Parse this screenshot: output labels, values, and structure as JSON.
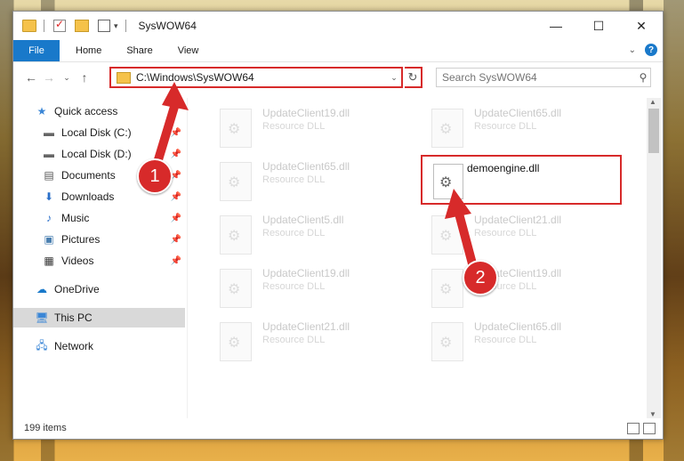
{
  "window": {
    "title": "SysWOW64"
  },
  "ribbon": {
    "tabs": [
      "File",
      "Home",
      "Share",
      "View"
    ]
  },
  "address": {
    "path": "C:\\Windows\\SysWOW64",
    "search_placeholder": "Search SysWOW64"
  },
  "sidebar": {
    "items": [
      {
        "label": "Quick access",
        "icon": "star-icon"
      },
      {
        "label": "Local Disk (C:)",
        "icon": "drive-icon"
      },
      {
        "label": "Local Disk (D:)",
        "icon": "drive-icon"
      },
      {
        "label": "Documents",
        "icon": "documents-icon"
      },
      {
        "label": "Downloads",
        "icon": "downloads-icon"
      },
      {
        "label": "Music",
        "icon": "music-icon"
      },
      {
        "label": "Pictures",
        "icon": "pictures-icon"
      },
      {
        "label": "Videos",
        "icon": "videos-icon"
      },
      {
        "label": "OneDrive",
        "icon": "cloud-icon"
      },
      {
        "label": "This PC",
        "icon": "computer-icon"
      },
      {
        "label": "Network",
        "icon": "network-icon"
      }
    ]
  },
  "files": [
    {
      "name": "UpdateClient19.dll",
      "type": "Resource DLL"
    },
    {
      "name": "UpdateClient65.dll",
      "type": "Resource DLL"
    },
    {
      "name": "UpdateClient65.dll",
      "type": "Resource DLL"
    },
    {
      "name": "UpdateClient5.dll",
      "type": "Resource DLL"
    },
    {
      "name": "UpdateClient21.dll",
      "type": "Resource DLL"
    },
    {
      "name": "UpdateClient19.dll",
      "type": "Resource DLL"
    },
    {
      "name": "UpdateClient19.dll",
      "type": "Resource DLL"
    },
    {
      "name": "UpdateClient21.dll",
      "type": "Resource DLL"
    },
    {
      "name": "UpdateClient65.dll",
      "type": "Resource DLL"
    }
  ],
  "highlighted_file": {
    "name": "demoengine.dll"
  },
  "status": {
    "items": "199 items"
  },
  "callouts": {
    "step1": "1",
    "step2": "2"
  },
  "colors": {
    "accent": "#1979ca",
    "highlight": "#d72a2a"
  }
}
